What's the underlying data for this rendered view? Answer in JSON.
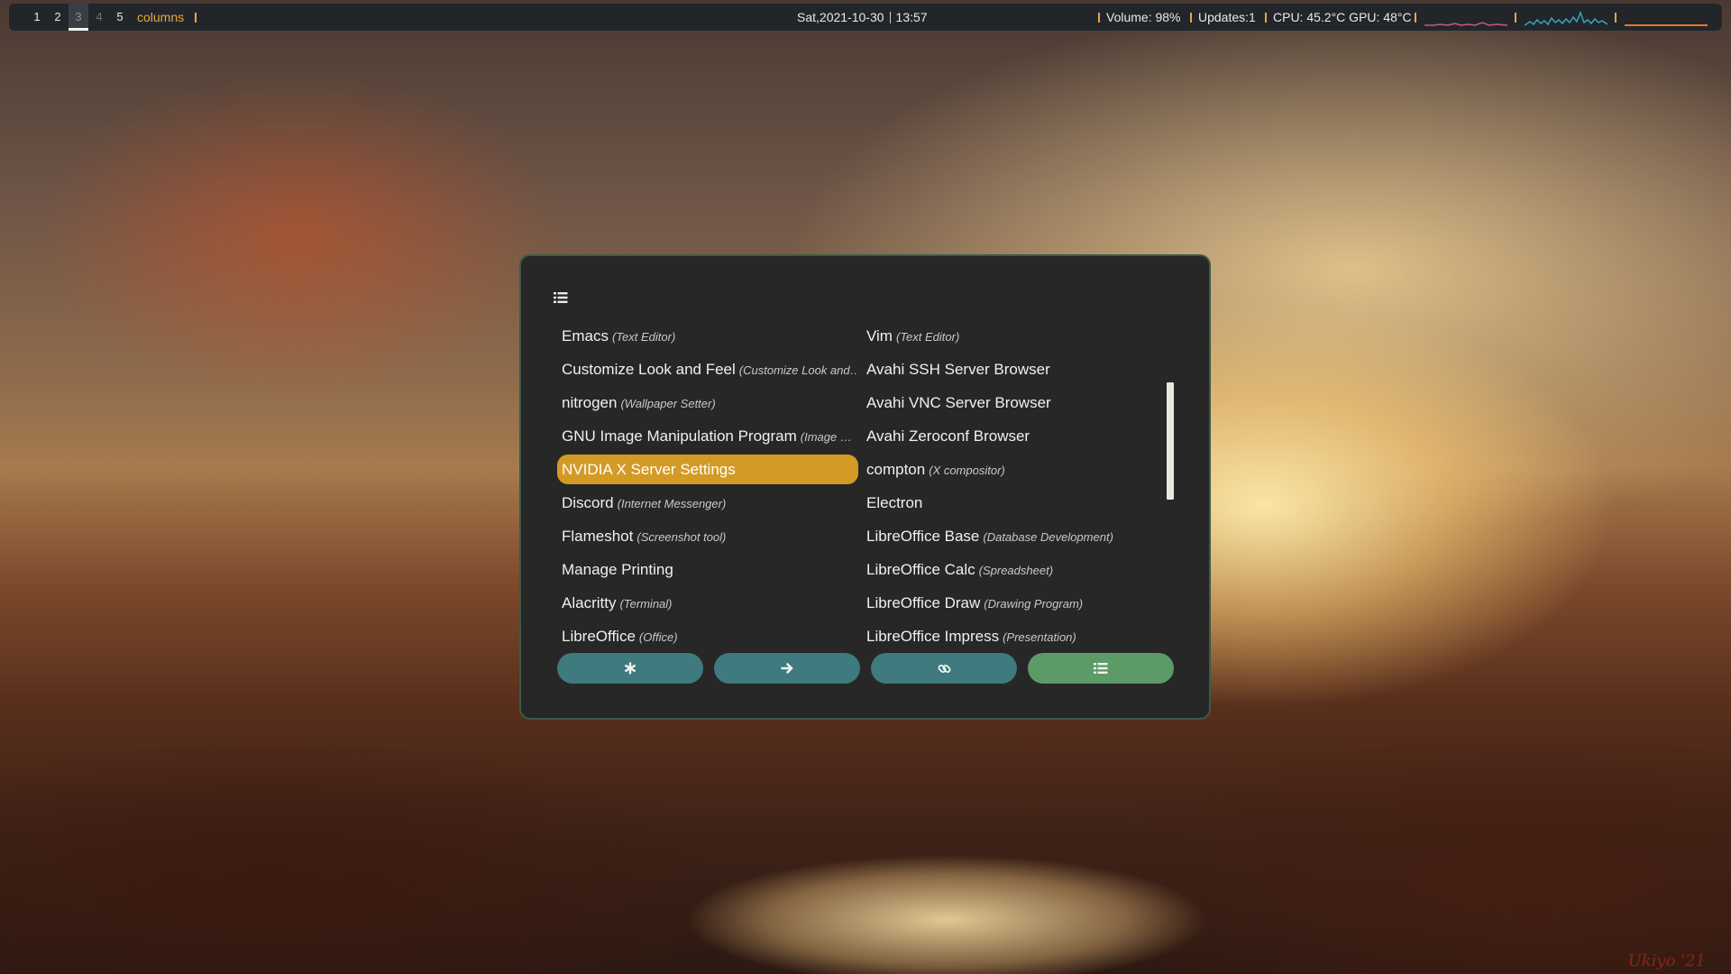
{
  "topbar": {
    "workspaces": [
      "1",
      "2",
      "3",
      "4",
      "5"
    ],
    "active_workspace": "3",
    "layout": "columns",
    "date": "Sat,2021-10-30",
    "time": "13:57",
    "volume": "Volume: 98%",
    "updates": "Updates:1",
    "temps": "CPU: 45.2°C GPU: 48°C",
    "graph_colors": [
      "#c35a8e",
      "#3aa3b5",
      "#e8762a"
    ]
  },
  "launcher": {
    "mode_icon": "list-icon",
    "left_column": [
      {
        "name": "Emacs",
        "desc": "(Text Editor)"
      },
      {
        "name": "Customize Look and Feel",
        "desc": "(Customize Look and…"
      },
      {
        "name": "nitrogen",
        "desc": "(Wallpaper Setter)"
      },
      {
        "name": "GNU Image Manipulation Program",
        "desc": "(Image …"
      },
      {
        "name": "NVIDIA X Server Settings",
        "desc": ""
      },
      {
        "name": "Discord",
        "desc": "(Internet Messenger)"
      },
      {
        "name": "Flameshot",
        "desc": "(Screenshot tool)"
      },
      {
        "name": "Manage Printing",
        "desc": ""
      },
      {
        "name": "Alacritty",
        "desc": "(Terminal)"
      },
      {
        "name": "LibreOffice",
        "desc": "(Office)"
      }
    ],
    "right_column": [
      {
        "name": "Vim",
        "desc": "(Text Editor)"
      },
      {
        "name": "Avahi SSH Server Browser",
        "desc": ""
      },
      {
        "name": "Avahi VNC Server Browser",
        "desc": ""
      },
      {
        "name": "Avahi Zeroconf Browser",
        "desc": ""
      },
      {
        "name": "compton",
        "desc": "(X compositor)"
      },
      {
        "name": "Electron",
        "desc": ""
      },
      {
        "name": "LibreOffice Base",
        "desc": "(Database Development)"
      },
      {
        "name": "LibreOffice Calc",
        "desc": "(Spreadsheet)"
      },
      {
        "name": "LibreOffice Draw",
        "desc": "(Drawing Program)"
      },
      {
        "name": "LibreOffice Impress",
        "desc": "(Presentation)"
      }
    ],
    "selected_item": "NVIDIA X Server Settings",
    "buttons": [
      {
        "icon": "asterisk-icon",
        "color": "#3e7a7e"
      },
      {
        "icon": "arrow-right-icon",
        "color": "#3e7a7e"
      },
      {
        "icon": "link-icon",
        "color": "#3e7a7e"
      },
      {
        "icon": "list-icon",
        "color": "#5c9a67"
      }
    ],
    "selection_color": "#d49a26"
  },
  "wallpaper": {
    "signature": "Ukiyo '21"
  }
}
